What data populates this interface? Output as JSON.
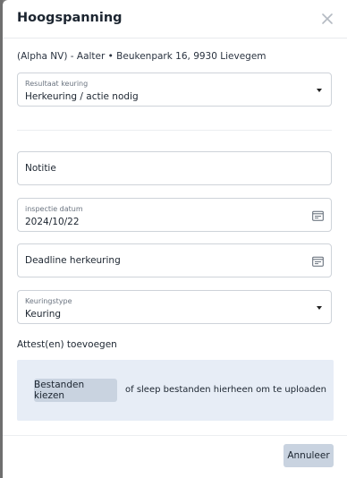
{
  "modal": {
    "title": "Hoogspanning",
    "subtitle": "(Alpha NV) - Aalter • Beukenpark 16, 9930 Lievegem"
  },
  "fields": {
    "resultaat": {
      "label": "Resultaat keuring",
      "value": "Herkeuring / actie nodig"
    },
    "notitie": {
      "placeholder": "Notitie"
    },
    "inspectie": {
      "label": "inspectie datum",
      "value": "2024/10/22"
    },
    "deadline": {
      "placeholder": "Deadline herkeuring"
    },
    "keuringstype": {
      "label": "Keuringstype",
      "value": "Keuring"
    }
  },
  "attachments": {
    "section_label": "Attest(en) toevoegen",
    "choose_button": "Bestanden kiezen",
    "drop_hint": "of sleep bestanden hierheen om te uploaden"
  },
  "footer": {
    "cancel_label": "Annuleer"
  },
  "icons": {
    "close": "close-icon",
    "caret": "chevron-down-icon",
    "calendar": "calendar-icon"
  },
  "colors": {
    "dropzone_bg": "#e7edf6",
    "button_bg": "#c9d3e0",
    "field_border": "#ced3d9"
  }
}
